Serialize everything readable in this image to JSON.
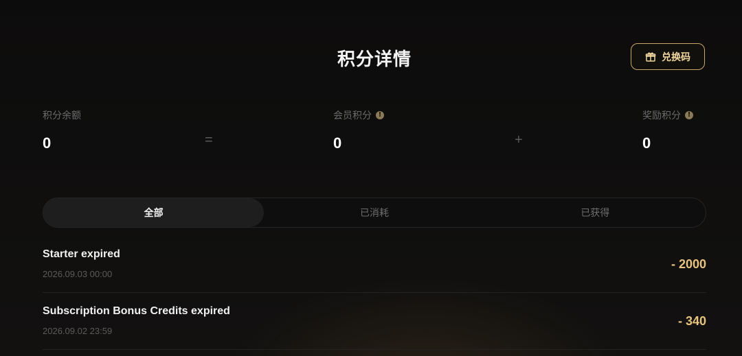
{
  "header": {
    "title": "积分详情",
    "redeem_label": "兑换码",
    "redeem_icon": "gift-icon"
  },
  "stats": {
    "balance": {
      "label": "积分余额",
      "value": "0"
    },
    "equals": "=",
    "member": {
      "label": "会员积分",
      "value": "0",
      "info_icon": "info-icon"
    },
    "plus": "+",
    "bonus": {
      "label": "奖励积分",
      "value": "0",
      "info_icon": "info-icon"
    }
  },
  "tabs": [
    {
      "label": "全部",
      "active": true
    },
    {
      "label": "已消耗",
      "active": false
    },
    {
      "label": "已获得",
      "active": false
    }
  ],
  "records": [
    {
      "title": "Starter expired",
      "time": "2026.09.03 00:00",
      "amount": "- 2000"
    },
    {
      "title": "Subscription Bonus Credits expired",
      "time": "2026.09.02 23:59",
      "amount": "- 340"
    }
  ],
  "colors": {
    "accent": "#e8c47e",
    "border_gold": "#c9a86a",
    "background": "#0d0c0c"
  }
}
